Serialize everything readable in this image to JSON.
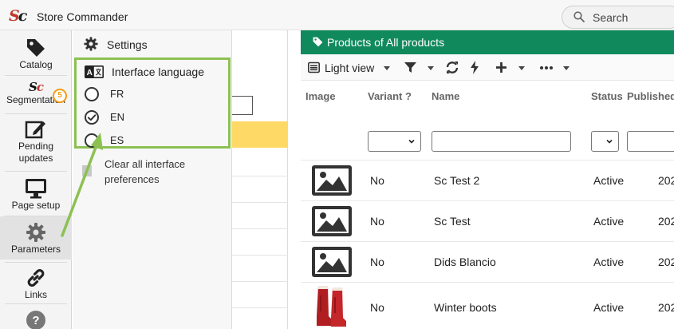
{
  "app": {
    "logo": "Sc",
    "title": "Store Commander"
  },
  "search": {
    "label": "Search"
  },
  "sidebar": {
    "items": [
      {
        "label": "Catalog",
        "icon": "tag-icon"
      },
      {
        "label": "Segmentation",
        "icon": "sc-logo-icon"
      },
      {
        "label": "Pending updates",
        "line1": "Pending",
        "line2": "updates",
        "icon": "edit-icon",
        "badge": "5"
      },
      {
        "label": "Page setup",
        "icon": "monitor-icon"
      },
      {
        "label": "Parameters",
        "icon": "gear-icon"
      },
      {
        "label": "Links",
        "icon": "link-icon"
      },
      {
        "label": "",
        "icon": "help-icon"
      }
    ]
  },
  "settings": {
    "title": "Settings",
    "language_section": {
      "title": "Interface language",
      "options": [
        {
          "code": "FR",
          "checked": false
        },
        {
          "code": "EN",
          "checked": true
        },
        {
          "code": "ES",
          "checked": false
        }
      ]
    },
    "clear_line1": "Clear all interface",
    "clear_line2": "preferences"
  },
  "products": {
    "header_title": "Products of All products",
    "toolbar": {
      "view_label": "Light view"
    },
    "columns": [
      "Image",
      "Variant ?",
      "Name",
      "Status",
      "Published"
    ],
    "rows": [
      {
        "image": "placeholder-image-icon",
        "variant": "No",
        "name": "Sc Test 2",
        "status": "Active",
        "published": "202"
      },
      {
        "image": "placeholder-image-icon",
        "variant": "No",
        "name": "Sc Test",
        "status": "Active",
        "published": "202"
      },
      {
        "image": "placeholder-image-icon",
        "variant": "No",
        "name": "Dids Blancio",
        "status": "Active",
        "published": "202"
      },
      {
        "image": "winter-boots-photo",
        "variant": "No",
        "name": "Winter boots",
        "status": "Active",
        "published": "202"
      }
    ]
  },
  "colors": {
    "accent_green": "#108a5c",
    "highlight_border": "#8cc152",
    "selected_row": "#ffd966",
    "badge": "#f39c12",
    "logo_red": "#c0392b"
  }
}
